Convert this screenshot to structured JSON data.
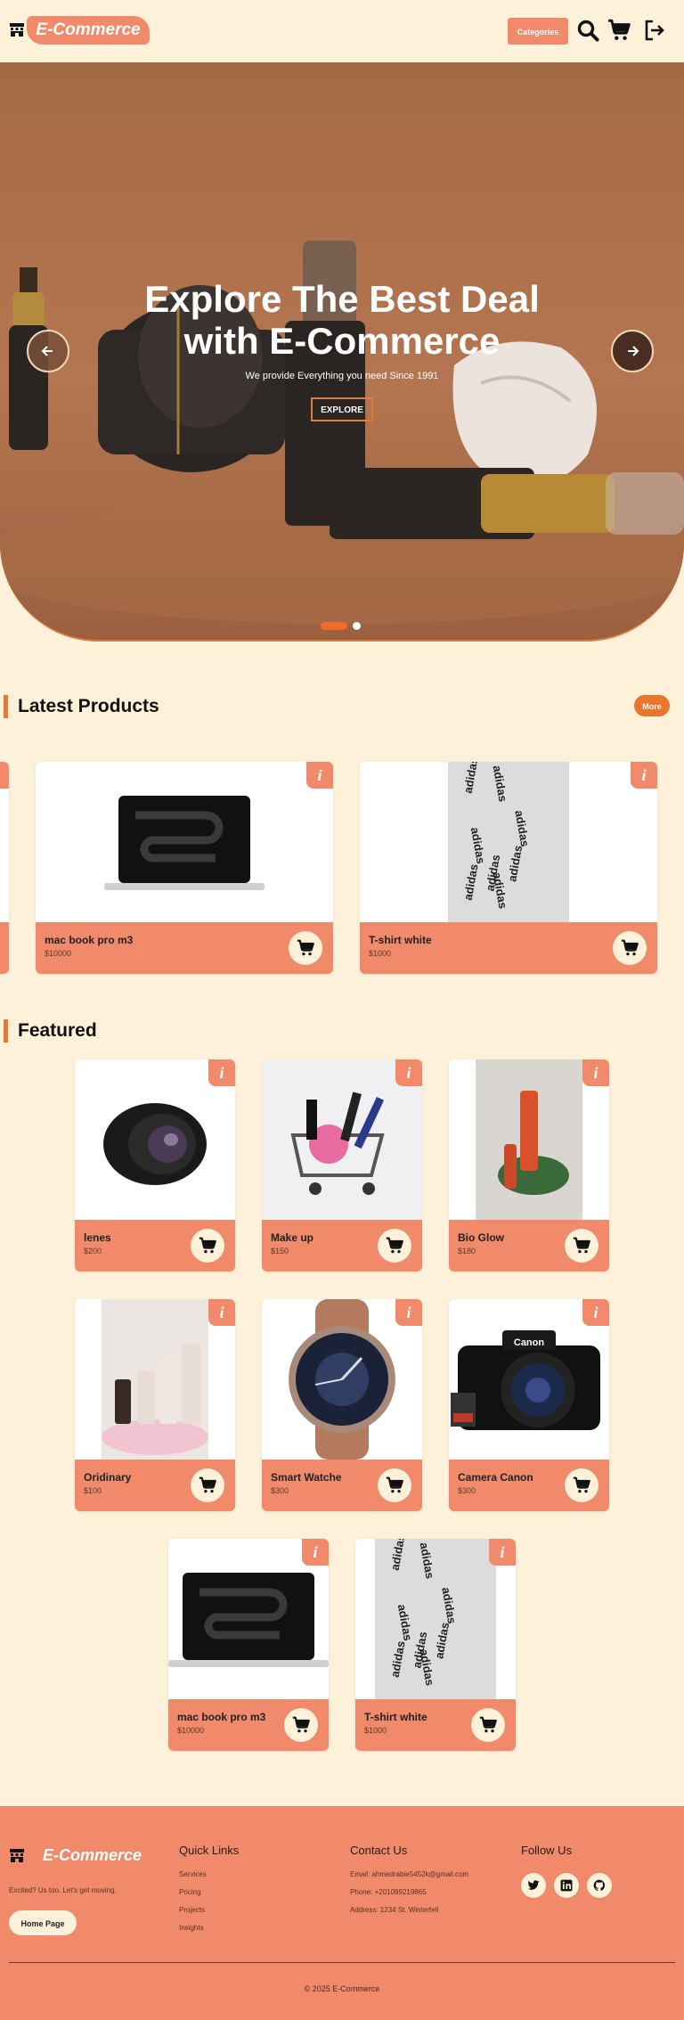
{
  "nav": {
    "brand": "E-Commerce",
    "categories_label": "Categories",
    "icons": [
      "shop-icon",
      "search-icon",
      "cart-icon",
      "logout-icon"
    ]
  },
  "hero": {
    "title_line1": "Explore The Best Deal",
    "title_line2": "with E-Commerce",
    "subtitle": "We provide Everything you need Since 1991",
    "explore_label": "EXPLORE",
    "slide_dots": 2,
    "active_slide": 1
  },
  "latest": {
    "title": "Latest Products",
    "more_label": "More",
    "products": [
      {
        "name": "mac book pro m3",
        "price": "$10000",
        "image": "laptop"
      },
      {
        "name": "T-shirt white",
        "price": "$1000",
        "image": "tshirt"
      }
    ]
  },
  "featured": {
    "title": "Featured",
    "products": [
      {
        "name": "lenes",
        "price": "$200",
        "image": "lens"
      },
      {
        "name": "Make up",
        "price": "$150",
        "image": "makeup"
      },
      {
        "name": "Bio Glow",
        "price": "$180",
        "image": "bioglow"
      },
      {
        "name": "Oridinary",
        "price": "$100",
        "image": "ordinary"
      },
      {
        "name": "Smart Watche",
        "price": "$300",
        "image": "watch"
      },
      {
        "name": "Camera Canon",
        "price": "$300",
        "image": "camera"
      },
      {
        "name": "mac book pro m3",
        "price": "$10000",
        "image": "laptop"
      },
      {
        "name": "T-shirt white",
        "price": "$1000",
        "image": "tshirt"
      }
    ]
  },
  "footer": {
    "brand": "E-Commerce",
    "tagline": "Excited? Us too. Let's get moving.",
    "home_label": "Home Page",
    "quick_links_title": "Quick Links",
    "quick_links": [
      "Services",
      "Pricing",
      "Projects",
      "Insights"
    ],
    "contact_title": "Contact Us",
    "contact": [
      "Email: ahmedrabie5452k@gmail.com",
      "Phone: +201099219865",
      "Address: 1234 St. Winterfell"
    ],
    "follow_title": "Follow Us",
    "social": [
      "twitter-icon",
      "linkedin-icon",
      "github-icon"
    ],
    "copyright": "© 2025 E-Commerce"
  },
  "colors": {
    "background": "#fdf1da",
    "accent": "#f08a6b",
    "orange": "#e8762e",
    "hero_bg": "#b07048"
  }
}
